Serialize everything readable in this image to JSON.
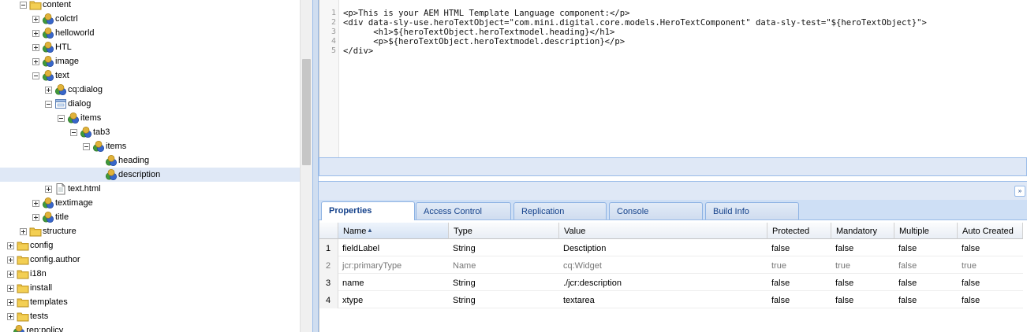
{
  "tree": {
    "nodes": [
      {
        "label": "content",
        "type": "folder",
        "toggle": "minus"
      },
      {
        "label": "colctrl",
        "type": "component",
        "toggle": "plus"
      },
      {
        "label": "helloworld",
        "type": "component",
        "toggle": "plus"
      },
      {
        "label": "HTL",
        "type": "component",
        "toggle": "plus"
      },
      {
        "label": "image",
        "type": "component",
        "toggle": "plus"
      },
      {
        "label": "text",
        "type": "component",
        "toggle": "minus"
      },
      {
        "label": "cq:dialog",
        "type": "component",
        "toggle": "plus"
      },
      {
        "label": "dialog",
        "type": "dialog",
        "toggle": "minus"
      },
      {
        "label": "items",
        "type": "component",
        "toggle": "minus"
      },
      {
        "label": "tab3",
        "type": "component",
        "toggle": "minus"
      },
      {
        "label": "items",
        "type": "component",
        "toggle": "minus"
      },
      {
        "label": "heading",
        "type": "component",
        "toggle": "none"
      },
      {
        "label": "description",
        "type": "component",
        "toggle": "none",
        "selected": true
      },
      {
        "label": "text.html",
        "type": "file",
        "toggle": "plus"
      },
      {
        "label": "textimage",
        "type": "component",
        "toggle": "plus"
      },
      {
        "label": "title",
        "type": "component",
        "toggle": "plus"
      },
      {
        "label": "structure",
        "type": "folder",
        "toggle": "plus"
      },
      {
        "label": "config",
        "type": "folder",
        "toggle": "plus"
      },
      {
        "label": "config.author",
        "type": "folder",
        "toggle": "plus"
      },
      {
        "label": "i18n",
        "type": "folder",
        "toggle": "plus"
      },
      {
        "label": "install",
        "type": "folder",
        "toggle": "plus"
      },
      {
        "label": "templates",
        "type": "folder",
        "toggle": "plus"
      },
      {
        "label": "tests",
        "type": "folder",
        "toggle": "plus"
      },
      {
        "label": "rep:policy",
        "type": "component",
        "toggle": "none"
      }
    ]
  },
  "editor": {
    "lines": [
      {
        "num": "1",
        "code": "<p>This is your AEM HTML Template Language component:</p>"
      },
      {
        "num": "2",
        "code": "<div data-sly-use.heroTextObject=\"com.mini.digital.core.models.HeroTextComponent\" data-sly-test=\"${heroTextObject}\">"
      },
      {
        "num": "3",
        "code": "      <h1>${heroTextObject.heroTextmodel.heading}</h1>"
      },
      {
        "num": "4",
        "code": "      <p>${heroTextObject.heroTextmodel.description}</p>"
      },
      {
        "num": "5",
        "code": "</div>"
      }
    ]
  },
  "tabs": [
    {
      "label": "Properties",
      "active": true
    },
    {
      "label": "Access Control"
    },
    {
      "label": "Replication"
    },
    {
      "label": "Console"
    },
    {
      "label": "Build Info"
    }
  ],
  "grid": {
    "columns": [
      "Name",
      "Type",
      "Value",
      "Protected",
      "Mandatory",
      "Multiple",
      "Auto Created"
    ],
    "sort_indicator": "▲",
    "rows": [
      {
        "num": "1",
        "cells": [
          "fieldLabel",
          "String",
          "Desctiption",
          "false",
          "false",
          "false",
          "false"
        ]
      },
      {
        "num": "2",
        "cells": [
          "jcr:primaryType",
          "Name",
          "cq:Widget",
          "true",
          "true",
          "false",
          "true"
        ],
        "dim": true
      },
      {
        "num": "3",
        "cells": [
          "name",
          "String",
          "./jcr:description",
          "false",
          "false",
          "false",
          "false"
        ]
      },
      {
        "num": "4",
        "cells": [
          "xtype",
          "String",
          "textarea",
          "false",
          "false",
          "false",
          "false"
        ]
      }
    ]
  },
  "collapse_icon": "chevrons-right-icon",
  "colors": {
    "accent": "#15428b",
    "selection": "#dfe8f6",
    "border": "#99bbe8"
  }
}
